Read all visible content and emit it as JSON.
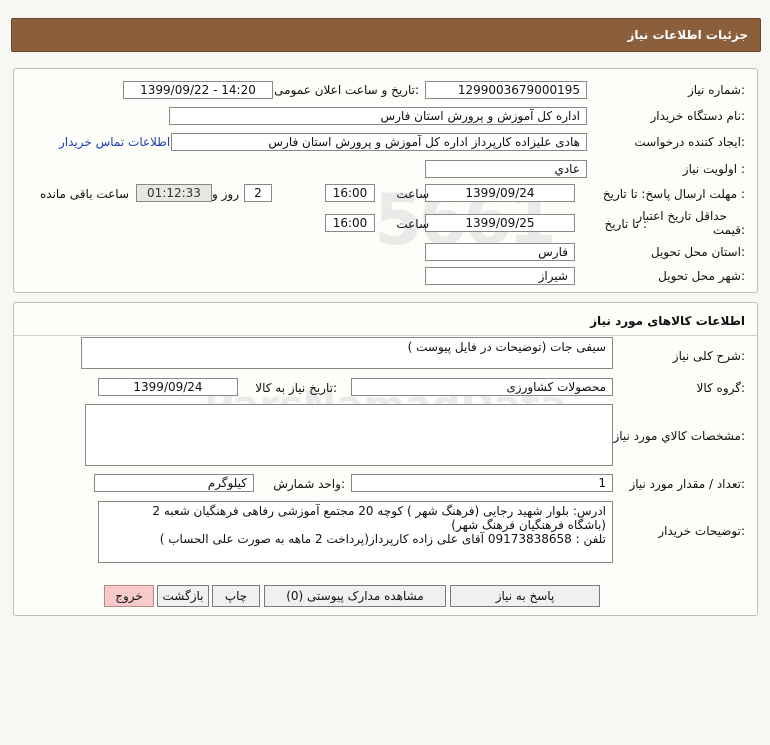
{
  "header": {
    "title": "جزئیات اطلاعات نیاز"
  },
  "need_info": {
    "need_number_label": "شماره نیاز:",
    "need_number": "1299003679000195",
    "announce_label": "تاریخ و ساعت اعلان عمومی:",
    "announce_value": "1399/09/22 - 14:20",
    "buyer_org_label": "نام دستگاه خریدار:",
    "buyer_org": "اداره کل آموزش و پرورش استان فارس",
    "requester_label": "ایجاد کننده درخواست:",
    "requester": "هادی علیزاده کارپرداز اداره کل آموزش و پرورش استان فارس",
    "contact_link": "اطلاعات تماس خریدار",
    "priority_label": "اولویت نیاز :",
    "priority": "عادي",
    "deadline_label": "مهلت ارسال پاسخ: تا تاریخ :",
    "deadline_date": "1399/09/24",
    "time_label": "ساعت",
    "deadline_time": "16:00",
    "days_value": "2",
    "days_label": "روز و",
    "remaining_time": "01:12:33",
    "remaining_label": "ساعت باقی مانده",
    "price_validity_label_1": "حداقل تاریخ اعتبار",
    "price_validity_label_2": "قیمت:",
    "price_validity_to": "تا تاریخ :",
    "price_validity_date": "1399/09/25",
    "price_validity_time": "16:00",
    "province_label": "استان محل تحویل:",
    "province": "فارس",
    "city_label": "شهر محل تحویل:",
    "city": "شیراز"
  },
  "goods": {
    "section_title": "اطلاعات کالاهای مورد نیاز",
    "general_desc_label": "شرح کلی نیاز:",
    "general_desc": "سیفی جات (توضیحات در فایل پیوست )",
    "group_label": "گروه کالا:",
    "group": "محصولات کشاورزی",
    "need_date_label": "تاریخ نیاز به کالا:",
    "need_date": "1399/09/24",
    "specs_label": "مشخصات کالاي مورد نياز:",
    "specs": "",
    "qty_label": "تعداد / مقدار مورد نیاز:",
    "qty": "1",
    "unit_label": "واحد شمارش:",
    "unit": "کیلوگرم",
    "buyer_notes_label": "توضیحات خریدار:",
    "buyer_notes": [
      "ادرس: بلوار شهید رجایی (فرهنگ شهر ) کوچه 20  مجتمع آموزشی رفاهی فرهنگیان شعبه 2",
      "(باشگاه فرهنگیان فرهنگ شهر)",
      "تلفن : 09173838658 آقای علی زاده کارپرداز(پرداخت 2 ماهه به صورت علی الحساب )"
    ]
  },
  "actions": {
    "reply": "پاسخ به نیاز",
    "attachments": "مشاهده مدارک پیوستی (0)",
    "print": "چاپ",
    "back": "بازگشت",
    "exit": "خروج"
  },
  "colors": {
    "header_bg": "#8b5e3c",
    "link": "#1f3fb5",
    "exit_button": "#f7c9c9"
  }
}
